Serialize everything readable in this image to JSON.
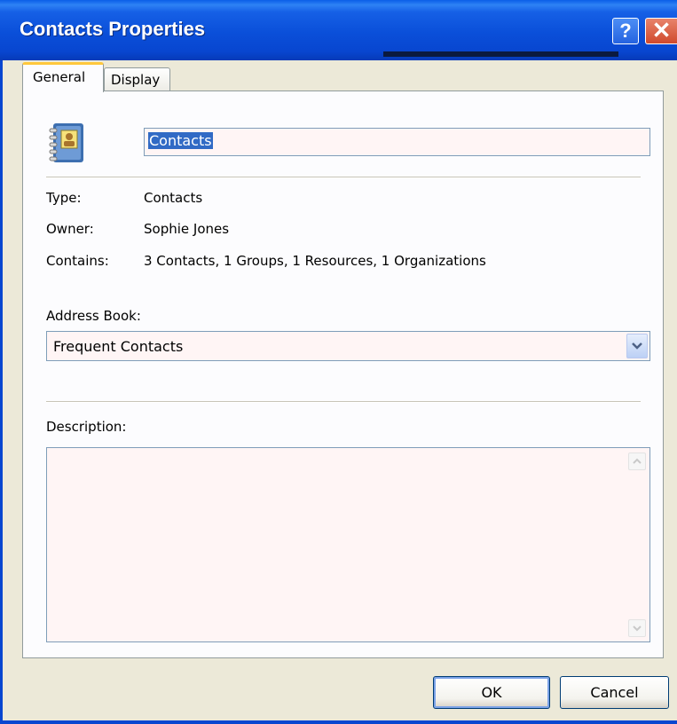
{
  "window": {
    "title": "Contacts Properties",
    "help_glyph": "?",
    "close_glyph": "✕"
  },
  "tabs": [
    {
      "label": "General"
    },
    {
      "label": "Display"
    }
  ],
  "general": {
    "name_value": "Contacts",
    "type_label": "Type:",
    "type_value": "Contacts",
    "owner_label": "Owner:",
    "owner_value": "Sophie Jones",
    "contains_label": "Contains:",
    "contains_value": "3 Contacts, 1 Groups, 1 Resources, 1 Organizations",
    "address_book_label": "Address Book:",
    "address_book_value": "Frequent Contacts",
    "description_label": "Description:",
    "description_value": ""
  },
  "buttons": {
    "ok": "OK",
    "cancel": "Cancel"
  },
  "icons": {
    "address_book": "address-book-icon",
    "dropdown": "chevron-down-icon",
    "scroll_up": "arrow-up-icon",
    "scroll_down": "arrow-down-icon"
  },
  "colors": {
    "titlebar": "#0846d0",
    "selection": "#316ac5",
    "field_bg": "#fff5f5",
    "dialog_bg": "#ece9d8"
  }
}
